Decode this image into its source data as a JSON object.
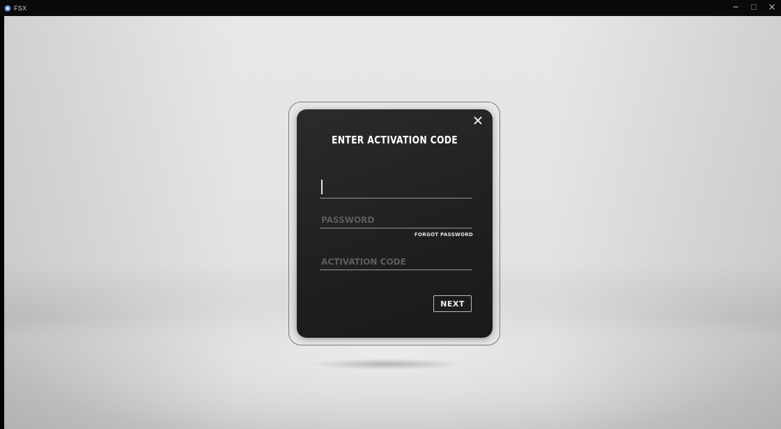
{
  "window": {
    "title": "FSX",
    "icon": "app-logo-icon",
    "controls": {
      "minimize_icon": "minimize-icon",
      "maximize_icon": "maximize-icon",
      "close_icon": "close-icon"
    }
  },
  "dialog": {
    "title": "ENTER ACTIVATION CODE",
    "close_icon": "close-icon",
    "username": {
      "value": "",
      "placeholder": ""
    },
    "password": {
      "value": "",
      "placeholder": "PASSWORD"
    },
    "forgot_password_label": "FORGOT PASSWORD",
    "activation_code": {
      "value": "",
      "placeholder": "ACTIVATION CODE"
    },
    "next_label": "NEXT"
  },
  "colors": {
    "dialog_background": "#222224",
    "text": "#ffffff",
    "placeholder": "#5d5d5f",
    "underline": "#9a9a9a",
    "stage_background": "#e4e4e4"
  }
}
